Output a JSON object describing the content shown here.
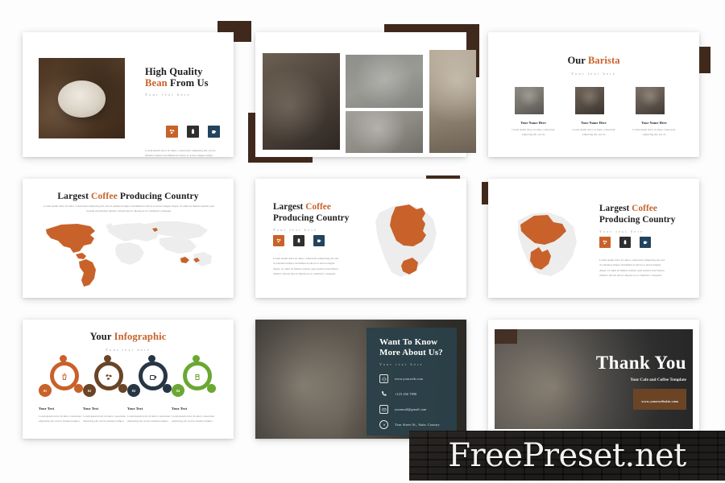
{
  "meta": {
    "watermark": "FreePreset.net",
    "accent_color": "#c8622a",
    "dark_color": "#40291c",
    "navy_color": "#2b4149",
    "green_color": "#6aa832",
    "brown_color": "#6b4426",
    "slide_bg": "#ffffff",
    "page_bg": "#fdfdfd"
  },
  "slides": [
    {
      "id": "high-quality-bean",
      "title_line1": "High Quality",
      "title_line2_accent": "Bean",
      "title_line2_rest": " From Us",
      "subtitle": "Your text here",
      "body": "Lorem ipsum dolor sit amet, consectetur adipiscing elit, sed do eiusmod tempor incididunt ut labore et dolore magna aliqua.",
      "icons": [
        "coffee-beans-icon",
        "coffee-pot-icon",
        "coffee-cup-icon"
      ]
    },
    {
      "id": "photo-grid",
      "photos": [
        "pouring-coffee-photo",
        "cappuccino-plate-photo",
        "hand-holding-latte-photo",
        "window-cup-photo"
      ]
    },
    {
      "id": "our-barista",
      "title_accent_before": "Our ",
      "title_accent": "Barista",
      "subtitle": "Your text here",
      "members": [
        {
          "name": "Your Name Here",
          "bio": "Lorem ipsum dolor sit amet, consectetur adipiscing elit, sed do"
        },
        {
          "name": "Your Name Here",
          "bio": "Lorem ipsum dolor sit amet, consectetur adipiscing elit, sed do"
        },
        {
          "name": "Your Name Here",
          "bio": "Lorem ipsum dolor sit amet, consectetur adipiscing elit, sed do"
        }
      ]
    },
    {
      "id": "largest-coffee-world",
      "title_pre": "Largest ",
      "title_accent": "Coffee",
      "title_post": " Producing Country",
      "body": "Lorem ipsum dolor sit amet, consectetur adipiscing elit, sed do eiusmod tempor incididunt ut labore et dolore magna aliqua. Ut enim ad minim veniam, quis nostrud exercitation ullamco laboris nisi ut aliquip ex ea commodo consequat.",
      "map": "world-map"
    },
    {
      "id": "largest-coffee-brazil",
      "title_pre": "Largest ",
      "title_accent": "Coffee",
      "title_line2": "Producing Country",
      "subtitle": "Your text here",
      "body": "Lorem ipsum dolor sit amet, consectetur adipiscing elit, sed do eiusmod tempor incididunt ut labore et dolore magna aliqua. Ut enim ad minim veniam, quis nostrud exercitation ullamco laboris nisi ut aliquip ex ea commodo consequat.",
      "icons": [
        "coffee-beans-icon",
        "coffee-pot-icon",
        "coffee-cup-icon"
      ],
      "map": "brazil-map"
    },
    {
      "id": "largest-coffee-bolivia",
      "title_pre": "Largest ",
      "title_accent": "Coffee",
      "title_line2": "Producing Country",
      "subtitle": "Your text here",
      "body": "Lorem ipsum dolor sit amet, consectetur adipiscing elit, sed do eiusmod tempor incididunt ut labore et dolore magna aliqua. Ut enim ad minim veniam, quis nostrud exercitation ullamco laboris nisi ut aliquip ex ea commodo consequat.",
      "icons": [
        "coffee-beans-icon",
        "coffee-pot-icon",
        "coffee-cup-icon"
      ],
      "map": "bolivia-map"
    },
    {
      "id": "your-infographic",
      "title_pre": "Your ",
      "title_accent": "Infographic",
      "subtitle": "Your text here",
      "items": [
        {
          "number": "01",
          "color": "#c8622a",
          "icon": "iced-coffee-icon",
          "label": "Your Text",
          "body": "Lorem ipsum dolor sit amet, consectetur adipiscing elit, sed do eiusmod tempor"
        },
        {
          "number": "02",
          "color": "#6b4426",
          "icon": "coffee-beans-icon",
          "label": "Your Text",
          "body": "Lorem ipsum dolor sit amet, consectetur adipiscing elit, sed do eiusmod tempor"
        },
        {
          "number": "03",
          "color": "#263645",
          "icon": "coffee-mug-icon",
          "label": "Your Text",
          "body": "Lorem ipsum dolor sit amet, consectetur adipiscing elit, sed do eiusmod tempor"
        },
        {
          "number": "04",
          "color": "#6aa832",
          "icon": "coffee-glass-icon",
          "label": "Your Text",
          "body": "Lorem ipsum dolor sit amet, consectetur adipiscing elit, sed do eiusmod tempor"
        }
      ]
    },
    {
      "id": "want-to-know-more",
      "title_line1": "Want To Know",
      "title_line2": "More About Us?",
      "subtitle": "Your text here",
      "contacts": [
        {
          "icon": "website-icon",
          "text": "www.yourweb.com"
        },
        {
          "icon": "phone-icon",
          "text": "+123 456 7890"
        },
        {
          "icon": "mail-icon",
          "text": "yourmail@gmail.com"
        },
        {
          "icon": "location-icon",
          "text": "Your Street St., State, Country"
        }
      ]
    },
    {
      "id": "thank-you",
      "title": "Thank You",
      "subtitle": "Your Cafe and Coffee Template",
      "button_label": "www.yourwebsite.com"
    }
  ]
}
